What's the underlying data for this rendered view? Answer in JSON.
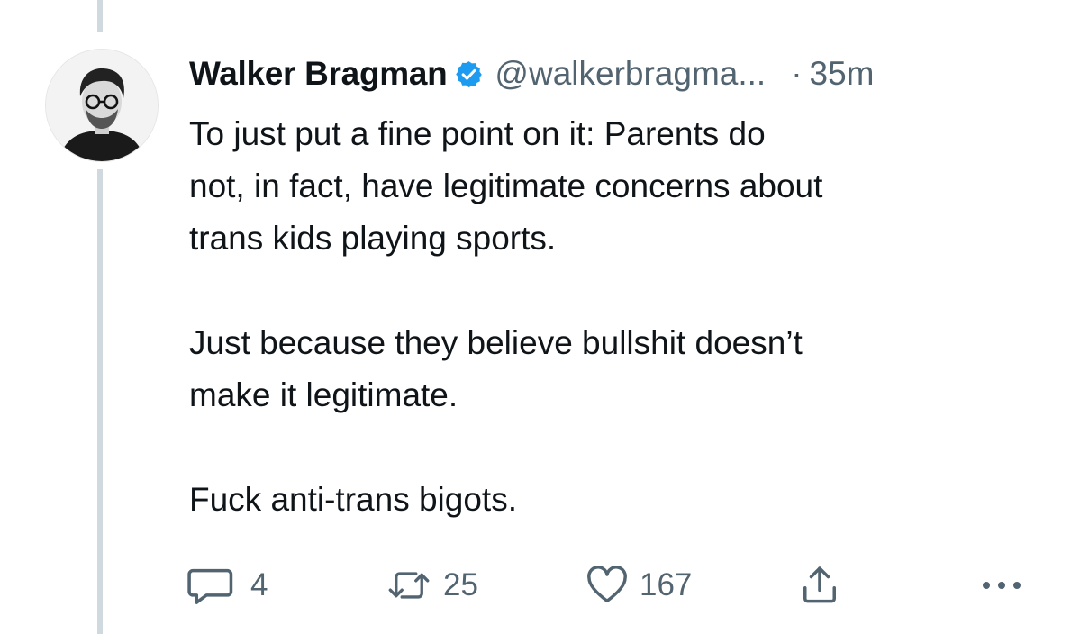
{
  "tweet": {
    "author": {
      "display_name": "Walker Bragman",
      "handle": "@walkerbragma...",
      "verified_icon": "verified-badge-icon",
      "avatar_icon": "profile-photo"
    },
    "separator": "·",
    "timestamp": "35m",
    "paragraphs": [
      "To just put a fine point on it: Parents do\nnot, in fact, have legitimate concerns about\ntrans kids playing sports.",
      "Just because they believe bullshit doesn’t\nmake it legitimate.",
      "Fuck anti-trans bigots."
    ],
    "actions": {
      "reply": {
        "icon": "reply-icon",
        "count": "4"
      },
      "retweet": {
        "icon": "retweet-icon",
        "count": "25"
      },
      "like": {
        "icon": "heart-icon",
        "count": "167"
      },
      "share": {
        "icon": "share-icon"
      },
      "more": {
        "icon": "more-icon"
      }
    }
  },
  "colors": {
    "text": "#0f1419",
    "secondary": "#536471",
    "verified": "#1d9bf0",
    "thread_line": "#cfd9de"
  }
}
